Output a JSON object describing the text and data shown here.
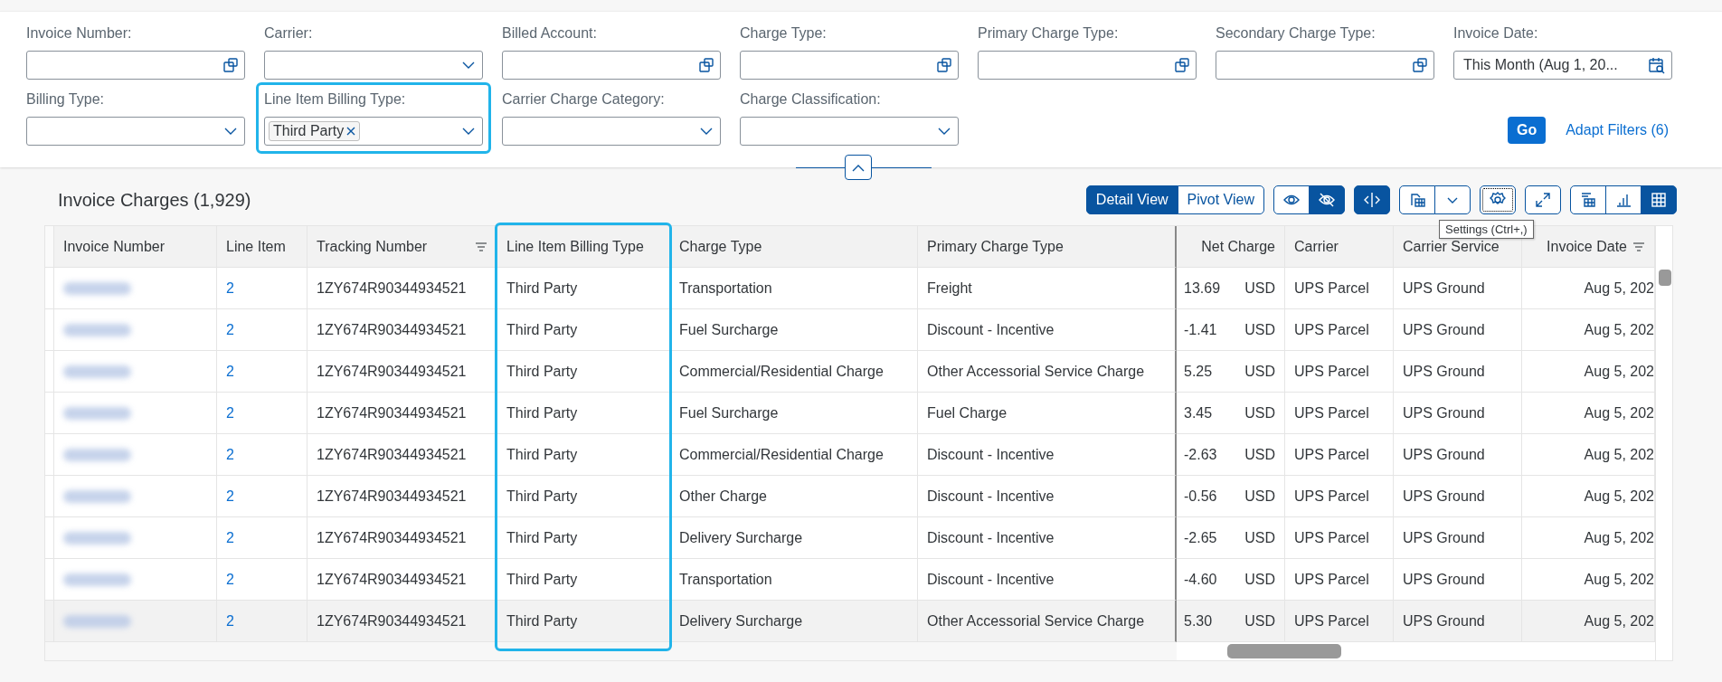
{
  "filters": [
    {
      "label": "Invoice Number:",
      "kind": "value-help",
      "highlighted": false
    },
    {
      "label": "Carrier:",
      "kind": "select",
      "highlighted": false
    },
    {
      "label": "Billed Account:",
      "kind": "value-help",
      "highlighted": false
    },
    {
      "label": "Charge Type:",
      "kind": "value-help",
      "highlighted": false
    },
    {
      "label": "Primary Charge Type:",
      "kind": "value-help",
      "highlighted": false
    },
    {
      "label": "Secondary Charge Type:",
      "kind": "value-help",
      "highlighted": false
    },
    {
      "label": "Invoice Date:",
      "kind": "date",
      "value": "This Month (Aug 1, 20...",
      "highlighted": false
    },
    {
      "label": "Billing Type:",
      "kind": "select",
      "highlighted": false
    },
    {
      "label": "Line Item Billing Type:",
      "kind": "select",
      "tokens": [
        "Third Party"
      ],
      "highlighted": true
    },
    {
      "label": "Carrier Charge Category:",
      "kind": "select",
      "highlighted": false
    },
    {
      "label": "Charge Classification:",
      "kind": "select",
      "highlighted": false
    }
  ],
  "go_button": "Go",
  "adapt_filters": "Adapt Filters (6)",
  "table": {
    "title": "Invoice Charges (1,929)",
    "views": [
      {
        "label": "Detail View",
        "selected": true
      },
      {
        "label": "Pivot View",
        "selected": false
      }
    ],
    "tool_groups": [
      [
        {
          "kind": "show",
          "selected": false,
          "focused": false
        },
        {
          "kind": "hide",
          "selected": true,
          "focused": false
        }
      ],
      [
        {
          "kind": "split",
          "selected": true,
          "focused": false
        }
      ],
      [
        {
          "kind": "export",
          "selected": false,
          "focused": false
        },
        {
          "kind": "menu",
          "selected": false,
          "focused": false
        }
      ],
      [
        {
          "kind": "settings",
          "selected": false,
          "focused": true
        }
      ],
      [
        {
          "kind": "fullscreen",
          "selected": false,
          "focused": false
        }
      ],
      [
        {
          "kind": "list",
          "selected": false,
          "focused": false
        },
        {
          "kind": "chart",
          "selected": false,
          "focused": false
        },
        {
          "kind": "grid",
          "selected": true,
          "focused": false
        }
      ]
    ],
    "tooltip": "Settings (Ctrl+,)",
    "columns": [
      {
        "label": "Invoice Number",
        "filtered": false,
        "highlighted": false
      },
      {
        "label": "Line Item",
        "filtered": false,
        "highlighted": false
      },
      {
        "label": "Tracking Number",
        "filtered": true,
        "highlighted": false
      },
      {
        "label": "Line Item Billing Type",
        "filtered": false,
        "highlighted": true
      },
      {
        "label": "Charge Type",
        "filtered": false,
        "highlighted": false
      },
      {
        "label": "Primary Charge Type",
        "filtered": false,
        "highlighted": false
      },
      {
        "label": "Net Charge",
        "filtered": false,
        "highlighted": false
      },
      {
        "label": "Carrier",
        "filtered": false,
        "highlighted": false
      },
      {
        "label": "Carrier Service",
        "filtered": false,
        "highlighted": false
      },
      {
        "label": "Invoice Date",
        "filtered": true,
        "highlighted": false
      }
    ],
    "rows": [
      {
        "line_item": "2",
        "tracking_number": "1ZY674R90344934521",
        "billing_type": "Third Party",
        "charge_type": "Transportation",
        "primary_charge_type": "Freight",
        "net_charge": "13.69",
        "currency": "USD",
        "carrier": "UPS Parcel",
        "carrier_service": "UPS Ground",
        "invoice_date": "Aug 5, 202",
        "hovered": false
      },
      {
        "line_item": "2",
        "tracking_number": "1ZY674R90344934521",
        "billing_type": "Third Party",
        "charge_type": "Fuel Surcharge",
        "primary_charge_type": "Discount - Incentive",
        "net_charge": "-1.41",
        "currency": "USD",
        "carrier": "UPS Parcel",
        "carrier_service": "UPS Ground",
        "invoice_date": "Aug 5, 202",
        "hovered": false
      },
      {
        "line_item": "2",
        "tracking_number": "1ZY674R90344934521",
        "billing_type": "Third Party",
        "charge_type": "Commercial/Residential Charge",
        "primary_charge_type": "Other Accessorial Service Charge",
        "net_charge": "5.25",
        "currency": "USD",
        "carrier": "UPS Parcel",
        "carrier_service": "UPS Ground",
        "invoice_date": "Aug 5, 202",
        "hovered": false
      },
      {
        "line_item": "2",
        "tracking_number": "1ZY674R90344934521",
        "billing_type": "Third Party",
        "charge_type": "Fuel Surcharge",
        "primary_charge_type": "Fuel Charge",
        "net_charge": "3.45",
        "currency": "USD",
        "carrier": "UPS Parcel",
        "carrier_service": "UPS Ground",
        "invoice_date": "Aug 5, 202",
        "hovered": false
      },
      {
        "line_item": "2",
        "tracking_number": "1ZY674R90344934521",
        "billing_type": "Third Party",
        "charge_type": "Commercial/Residential Charge",
        "primary_charge_type": "Discount - Incentive",
        "net_charge": "-2.63",
        "currency": "USD",
        "carrier": "UPS Parcel",
        "carrier_service": "UPS Ground",
        "invoice_date": "Aug 5, 202",
        "hovered": false
      },
      {
        "line_item": "2",
        "tracking_number": "1ZY674R90344934521",
        "billing_type": "Third Party",
        "charge_type": "Other Charge",
        "primary_charge_type": "Discount - Incentive",
        "net_charge": "-0.56",
        "currency": "USD",
        "carrier": "UPS Parcel",
        "carrier_service": "UPS Ground",
        "invoice_date": "Aug 5, 202",
        "hovered": false
      },
      {
        "line_item": "2",
        "tracking_number": "1ZY674R90344934521",
        "billing_type": "Third Party",
        "charge_type": "Delivery Surcharge",
        "primary_charge_type": "Discount - Incentive",
        "net_charge": "-2.65",
        "currency": "USD",
        "carrier": "UPS Parcel",
        "carrier_service": "UPS Ground",
        "invoice_date": "Aug 5, 202",
        "hovered": false
      },
      {
        "line_item": "2",
        "tracking_number": "1ZY674R90344934521",
        "billing_type": "Third Party",
        "charge_type": "Transportation",
        "primary_charge_type": "Discount - Incentive",
        "net_charge": "-4.60",
        "currency": "USD",
        "carrier": "UPS Parcel",
        "carrier_service": "UPS Ground",
        "invoice_date": "Aug 5, 202",
        "hovered": false
      },
      {
        "line_item": "2",
        "tracking_number": "1ZY674R90344934521",
        "billing_type": "Third Party",
        "charge_type": "Delivery Surcharge",
        "primary_charge_type": "Other Accessorial Service Charge",
        "net_charge": "5.30",
        "currency": "USD",
        "carrier": "UPS Parcel",
        "carrier_service": "UPS Ground",
        "invoice_date": "Aug 5, 202",
        "hovered": true
      }
    ]
  }
}
